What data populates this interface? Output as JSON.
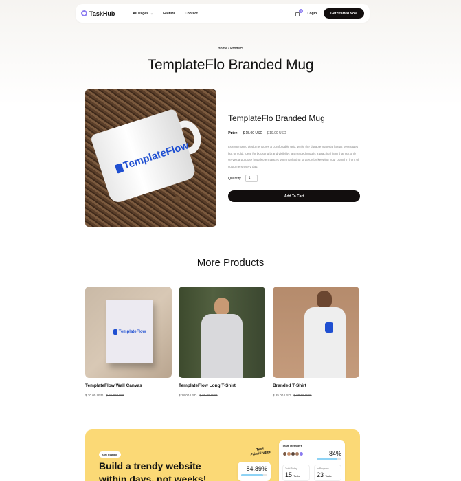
{
  "nav": {
    "brand": "TaskHub",
    "links": [
      "All Pages",
      "Feature",
      "Contact"
    ],
    "cart_count": "0",
    "login": "Login",
    "cta": "Get Started Now"
  },
  "breadcrumb": "Home / Product",
  "page_title": "TemplateFlo Branded Mug",
  "product": {
    "image_logo_text": "TemplateFlow",
    "title": "TemplateFlo Branded Mug",
    "price_label": "Price:",
    "price": "$ 15.00 USD",
    "old_price": "$ 19.00 USD",
    "description": "Its ergonomic design ensures a comfortable grip, while the durable material keeps beverages hot or cold. Ideal for boosting brand visibility, a Branded Mug is a practical item that not only serves a purpose but also enhances your marketing strategy by keeping your brand in front of customers every day.",
    "quantity_label": "Quantity",
    "quantity_value": "1",
    "add_to_cart": "Add To Cart"
  },
  "more": {
    "title": "More Products",
    "items": [
      {
        "name": "TemplateFlow Wall Canvas",
        "price": "$ 20.00 USD",
        "old_price": "$ 25.00 USD",
        "image_text": "TemplateFlow"
      },
      {
        "name": "TemplateFlow Long T-Shirt",
        "price": "$ 18.00 USD",
        "old_price": "$ 20.00 USD"
      },
      {
        "name": "Branded T-Shirt",
        "price": "$ 25.00 USD",
        "old_price": "$ 30.00 USD"
      }
    ]
  },
  "banner": {
    "pill": "Get Started",
    "title": "Build a trendy website within days, not weeks!",
    "task_label": "Task Prioritization",
    "team_label": "Team Members",
    "pct_small": "84.89%",
    "pct_large": "84%",
    "total_label": "Total Today",
    "total_value": "15",
    "total_unit": "Tasks",
    "progress_label": "In Progress",
    "progress_value": "23",
    "progress_unit": "Tasks"
  }
}
